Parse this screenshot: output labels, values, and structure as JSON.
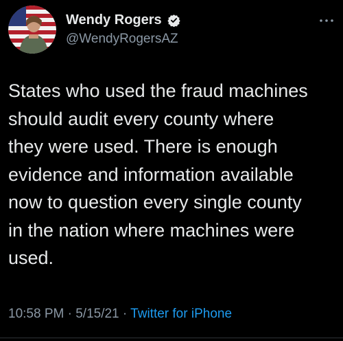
{
  "author": {
    "display_name": "Wendy Rogers",
    "handle": "@WendyRogersAZ",
    "verified": true,
    "avatar_icon": "profile-photo-flag-background-icon"
  },
  "tweet": {
    "lines": [
      "States who used the fraud machines",
      "should audit every county where",
      "they were used. There is enough",
      "evidence and information available",
      "now to question every single county",
      "in the nation where machines were",
      "used."
    ]
  },
  "meta": {
    "time": "10:58 PM",
    "separator": " · ",
    "date": "5/15/21",
    "source": "Twitter for iPhone"
  },
  "colors": {
    "background": "#000000",
    "text": "#e7e9ea",
    "secondary": "#8b98a5",
    "link": "#1d9bf0"
  }
}
